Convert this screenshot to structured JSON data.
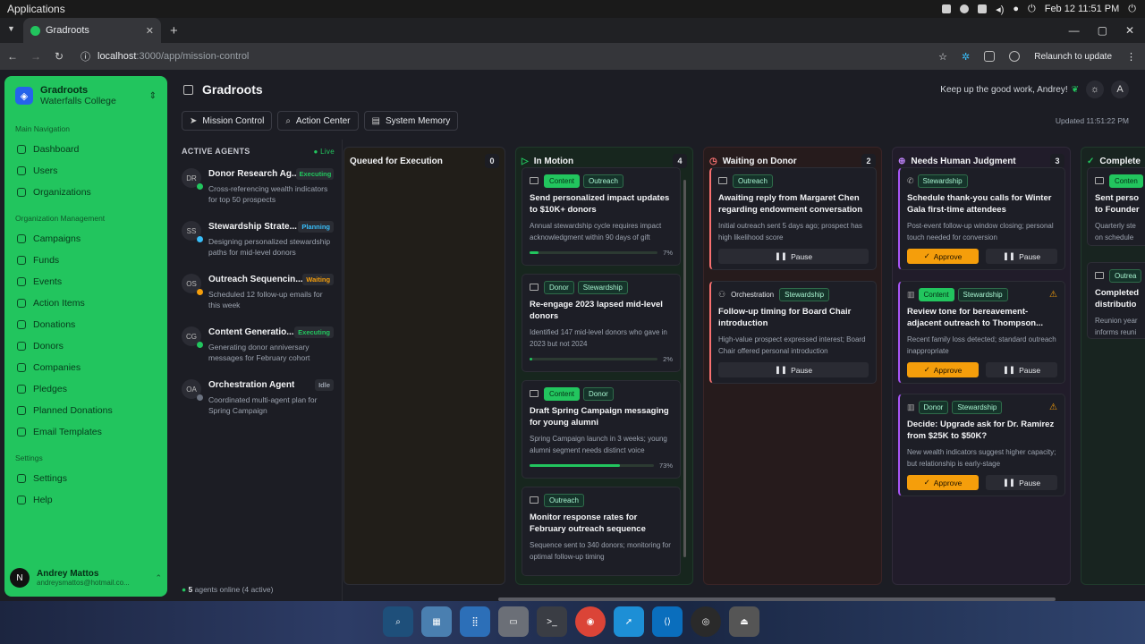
{
  "os": {
    "apps_label": "Applications",
    "clock": "Feb 12  11:51 PM"
  },
  "browser": {
    "tab_title": "Gradroots",
    "url_host": "localhost",
    "url_rest": ":3000/app/mission-control",
    "relaunch": "Relaunch to update"
  },
  "sidebar": {
    "org_name": "Gradroots",
    "org_sub": "Waterfalls College",
    "section_main": "Main Navigation",
    "main_items": [
      "Dashboard",
      "Users",
      "Organizations"
    ],
    "section_org": "Organization Management",
    "org_items": [
      "Campaigns",
      "Funds",
      "Events",
      "Action Items",
      "Donations",
      "Donors",
      "Companies",
      "Pledges",
      "Planned Donations",
      "Email Templates"
    ],
    "section_settings": "Settings",
    "settings_items": [
      "Settings",
      "Help"
    ],
    "user_initial": "N",
    "user_name": "Andrey Mattos",
    "user_email": "andreysmattos@hotmail.co..."
  },
  "header": {
    "title": "Gradroots",
    "message": "Keep up the good work, Andrey!",
    "avatar": "A",
    "tabs": [
      "Mission Control",
      "Action Center",
      "System Memory"
    ],
    "updated": "Updated 11:51:22 PM"
  },
  "agents": {
    "heading": "ACTIVE AGENTS",
    "live": "Live",
    "list": [
      {
        "initials": "DR",
        "name": "Donor Research Ag...",
        "status": "Executing",
        "desc": "Cross-referencing wealth indicators for top 50 prospects",
        "color": "#22c55e"
      },
      {
        "initials": "SS",
        "name": "Stewardship Strate...",
        "status": "Planning",
        "desc": "Designing personalized stewardship paths for mid-level donors",
        "color": "#38bdf8"
      },
      {
        "initials": "OS",
        "name": "Outreach Sequencin...",
        "status": "Waiting",
        "desc": "Scheduled 12 follow-up emails for this week",
        "color": "#f59e0b"
      },
      {
        "initials": "CG",
        "name": "Content Generatio...",
        "status": "Executing",
        "desc": "Generating donor anniversary messages for February cohort",
        "color": "#22c55e"
      },
      {
        "initials": "OA",
        "name": "Orchestration Agent",
        "status": "Idle",
        "desc": "Coordinated multi-agent plan for Spring Campaign",
        "color": "#6b7280"
      }
    ],
    "footer_count": "5",
    "footer_text": "agents online (4 active)"
  },
  "columns": [
    {
      "title": "Queued for Execution",
      "count": "0"
    },
    {
      "title": "In Motion",
      "count": "4"
    },
    {
      "title": "Waiting on Donor",
      "count": "2"
    },
    {
      "title": "Needs Human Judgment",
      "count": "3"
    },
    {
      "title": "Complete",
      "count": ""
    }
  ],
  "cards": {
    "motion": [
      {
        "tags": [
          "Content",
          "Outreach"
        ],
        "title": "Send personalized impact updates to $10K+ donors",
        "desc": "Annual stewardship cycle requires impact acknowledgment within 90 days of gift",
        "progress": 7,
        "pct": "7%"
      },
      {
        "tags": [
          "Donor",
          "Stewardship"
        ],
        "title": "Re-engage 2023 lapsed mid-level donors",
        "desc": "Identified 147 mid-level donors who gave in 2023 but not 2024",
        "progress": 2,
        "pct": "2%"
      },
      {
        "tags": [
          "Content",
          "Donor"
        ],
        "title": "Draft Spring Campaign messaging for young alumni",
        "desc": "Spring Campaign launch in 3 weeks; young alumni segment needs distinct voice",
        "progress": 73,
        "pct": "73%"
      },
      {
        "tags": [
          "Outreach"
        ],
        "title": "Monitor response rates for February outreach sequence",
        "desc": "Sequence sent to 340 donors; monitoring for optimal follow-up timing"
      }
    ],
    "waiting": [
      {
        "tags": [
          "Outreach"
        ],
        "title": "Awaiting reply from Margaret Chen regarding endowment conversation",
        "desc": "Initial outreach sent 5 days ago; prospect has high likelihood score",
        "pause": "Pause"
      },
      {
        "tags": [
          "Orchestration",
          "Stewardship"
        ],
        "title": "Follow-up timing for Board Chair introduction",
        "desc": "High-value prospect expressed interest; Board Chair offered personal introduction",
        "pause": "Pause"
      }
    ],
    "judgment": [
      {
        "tags": [
          "Stewardship"
        ],
        "title": "Schedule thank-you calls for Winter Gala first-time attendees",
        "desc": "Post-event follow-up window closing; personal touch needed for conversion",
        "approve": "Approve",
        "pause": "Pause"
      },
      {
        "tags": [
          "Content",
          "Stewardship"
        ],
        "title": "Review tone for bereavement-adjacent outreach to Thompson...",
        "desc": "Recent family loss detected; standard outreach inappropriate",
        "approve": "Approve",
        "pause": "Pause"
      },
      {
        "tags": [
          "Donor",
          "Stewardship"
        ],
        "title": "Decide: Upgrade ask for Dr. Ramirez from $25K to $50K?",
        "desc": "New wealth indicators suggest higher capacity; but relationship is early-stage",
        "approve": "Approve",
        "pause": "Pause"
      }
    ],
    "complete": [
      {
        "tags": [
          "Conten"
        ],
        "title": "Sent perso to Founder",
        "desc": "Quarterly ste on schedule"
      },
      {
        "tags": [
          "Outrea"
        ],
        "title": "Completed distributio",
        "desc": "Reunion year informs reuni"
      }
    ]
  }
}
